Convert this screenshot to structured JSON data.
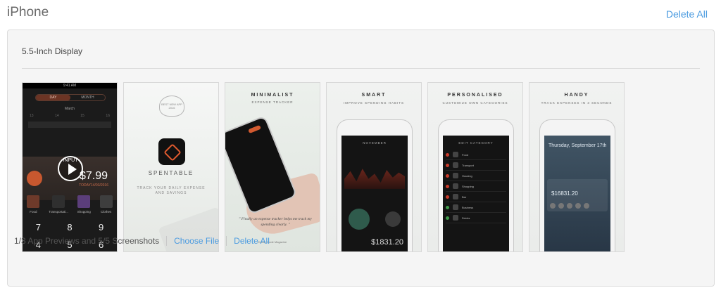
{
  "header": {
    "title": "iPhone",
    "delete_all": "Delete All"
  },
  "panel": {
    "display_label": "5.5-Inch Display"
  },
  "screenshots": [
    {
      "kind": "app-preview",
      "status_time": "9:41 AM",
      "tabs": [
        "DAY",
        "MONTH"
      ],
      "month": "March",
      "calendar_row": [
        "13",
        "14",
        "15",
        "16"
      ],
      "play_label": "INPUT",
      "amount": "$7.99",
      "date": "TODAY14/03/2016",
      "categories": [
        "Food",
        "Transportati...",
        "Shopping",
        "Clothes"
      ],
      "keypad": [
        "7",
        "8",
        "9",
        "4",
        "5",
        "6"
      ]
    },
    {
      "kind": "branding",
      "badge": "BEST NEW APP 2016",
      "app_name": "SPENTABLE",
      "tagline": "TRACK YOUR DAILY EXPENSE AND SAVINGS"
    },
    {
      "kind": "minimalist",
      "heading": "MINIMALIST",
      "subheading": "EXPENSE TRACKER",
      "quote": "\" Finally an expense tracker helps me track my spending clearly. \"",
      "author": "David, Code Magazine"
    },
    {
      "kind": "smart",
      "heading": "SMART",
      "subheading": "IMPROVE SPENDING HABITS",
      "screen_title": "NOVEMBER",
      "total": "$1831.20"
    },
    {
      "kind": "personalised",
      "heading": "PERSONALISED",
      "subheading": "CUSTOMIZE OWN CATEGORIES",
      "screen_title": "EDIT CATEGORY",
      "items": [
        "Food",
        "Transport",
        "Housing",
        "Shopping",
        "Bar",
        "Business",
        "Drinks"
      ]
    },
    {
      "kind": "handy",
      "heading": "HANDY",
      "subheading": "TRACK EXPENSES IN 3 SECONDS",
      "lock_title": "Thursday, September 17th",
      "amount": "$16831.20"
    }
  ],
  "footer": {
    "summary": "1/3 App Previews and 5/5 Screenshots",
    "choose_file": "Choose File",
    "delete_all": "Delete All"
  },
  "colors": {
    "link": "#4a9be0",
    "accent": "#d35a30"
  }
}
